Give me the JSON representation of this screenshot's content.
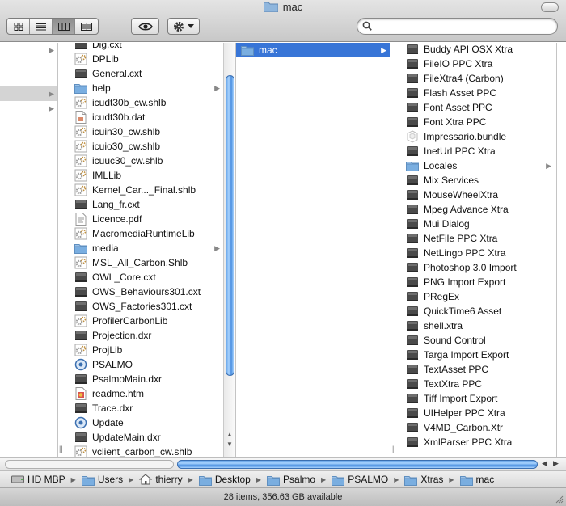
{
  "window": {
    "title": "mac"
  },
  "toolbar": {
    "view_modes": [
      "icon-view-icon",
      "list-view-icon",
      "column-view-icon",
      "coverflow-view-icon"
    ],
    "active_view": 2,
    "quicklook_icon": "eye-icon",
    "action_icon": "gear-icon",
    "search_placeholder": ""
  },
  "sidebar": {
    "rows": [
      {
        "has_arrow": true,
        "selected": false
      },
      {
        "has_arrow": false,
        "selected": false
      },
      {
        "has_arrow": false,
        "selected": false
      },
      {
        "has_arrow": true,
        "selected": true
      }
    ]
  },
  "column1": {
    "items": [
      {
        "name": "Dig.cxt",
        "icon": "xtra",
        "partial": true
      },
      {
        "name": "DPLib",
        "icon": "lib"
      },
      {
        "name": "General.cxt",
        "icon": "xtra"
      },
      {
        "name": "help",
        "icon": "folder",
        "arrow": true
      },
      {
        "name": "icudt30b_cw.shlb",
        "icon": "lib"
      },
      {
        "name": "icudt30b.dat",
        "icon": "dat"
      },
      {
        "name": "icuin30_cw.shlb",
        "icon": "lib"
      },
      {
        "name": "icuio30_cw.shlb",
        "icon": "lib"
      },
      {
        "name": "icuuc30_cw.shlb",
        "icon": "lib"
      },
      {
        "name": "IMLLib",
        "icon": "lib"
      },
      {
        "name": "Kernel_Car..._Final.shlb",
        "icon": "lib"
      },
      {
        "name": "Lang_fr.cxt",
        "icon": "xtra"
      },
      {
        "name": "Licence.pdf",
        "icon": "pdf"
      },
      {
        "name": "MacromediaRuntimeLib",
        "icon": "lib"
      },
      {
        "name": "media",
        "icon": "folder",
        "arrow": true
      },
      {
        "name": "MSL_All_Carbon.Shlb",
        "icon": "lib"
      },
      {
        "name": "OWL_Core.cxt",
        "icon": "xtra"
      },
      {
        "name": "OWS_Behaviours301.cxt",
        "icon": "xtra"
      },
      {
        "name": "OWS_Factories301.cxt",
        "icon": "xtra"
      },
      {
        "name": "ProfilerCarbonLib",
        "icon": "lib"
      },
      {
        "name": "Projection.dxr",
        "icon": "xtra"
      },
      {
        "name": "ProjLib",
        "icon": "lib"
      },
      {
        "name": "PSALMO",
        "icon": "app"
      },
      {
        "name": "PsalmoMain.dxr",
        "icon": "xtra"
      },
      {
        "name": "readme.htm",
        "icon": "htm"
      },
      {
        "name": "Trace.dxr",
        "icon": "xtra"
      },
      {
        "name": "Update",
        "icon": "app"
      },
      {
        "name": "UpdateMain.dxr",
        "icon": "xtra"
      },
      {
        "name": "vclient_carbon_cw.shlb",
        "icon": "lib"
      }
    ]
  },
  "column2": {
    "items": [
      {
        "name": "mac",
        "icon": "folder",
        "arrow": true,
        "selected": true
      }
    ]
  },
  "column3": {
    "items": [
      {
        "name": "Buddy API OSX Xtra",
        "icon": "xtra"
      },
      {
        "name": "FileIO PPC Xtra",
        "icon": "xtra"
      },
      {
        "name": "FileXtra4 (Carbon)",
        "icon": "xtra"
      },
      {
        "name": "Flash Asset PPC",
        "icon": "xtra"
      },
      {
        "name": "Font Asset PPC",
        "icon": "xtra"
      },
      {
        "name": "Font Xtra PPC",
        "icon": "xtra"
      },
      {
        "name": "Impressario.bundle",
        "icon": "bundle"
      },
      {
        "name": "InetUrl PPC Xtra",
        "icon": "xtra"
      },
      {
        "name": "Locales",
        "icon": "folder",
        "arrow": true
      },
      {
        "name": "Mix Services",
        "icon": "xtra"
      },
      {
        "name": "MouseWheelXtra",
        "icon": "xtra"
      },
      {
        "name": "Mpeg Advance Xtra",
        "icon": "xtra"
      },
      {
        "name": "Mui Dialog",
        "icon": "xtra"
      },
      {
        "name": "NetFile PPC Xtra",
        "icon": "xtra"
      },
      {
        "name": "NetLingo PPC Xtra",
        "icon": "xtra"
      },
      {
        "name": "Photoshop 3.0 Import",
        "icon": "xtra"
      },
      {
        "name": "PNG Import Export",
        "icon": "xtra"
      },
      {
        "name": "PRegEx",
        "icon": "xtra"
      },
      {
        "name": "QuickTime6 Asset",
        "icon": "xtra"
      },
      {
        "name": "shell.xtra",
        "icon": "xtra"
      },
      {
        "name": "Sound Control",
        "icon": "xtra"
      },
      {
        "name": "Targa Import Export",
        "icon": "xtra"
      },
      {
        "name": "TextAsset PPC",
        "icon": "xtra"
      },
      {
        "name": "TextXtra PPC",
        "icon": "xtra"
      },
      {
        "name": "Tiff Import Export",
        "icon": "xtra"
      },
      {
        "name": "UIHelper PPC Xtra",
        "icon": "xtra"
      },
      {
        "name": "V4MD_Carbon.Xtr",
        "icon": "xtra"
      },
      {
        "name": "XmlParser PPC Xtra",
        "icon": "xtra"
      }
    ]
  },
  "pathbar": {
    "crumbs": [
      {
        "name": "HD MBP",
        "icon": "disk"
      },
      {
        "name": "Users",
        "icon": "folder"
      },
      {
        "name": "thierry",
        "icon": "home"
      },
      {
        "name": "Desktop",
        "icon": "folder"
      },
      {
        "name": "Psalmo",
        "icon": "folder"
      },
      {
        "name": "PSALMO",
        "icon": "folder"
      },
      {
        "name": "Xtras",
        "icon": "folder"
      },
      {
        "name": "mac",
        "icon": "folder"
      }
    ]
  },
  "status": {
    "text": "28 items, 356.63 GB available"
  }
}
